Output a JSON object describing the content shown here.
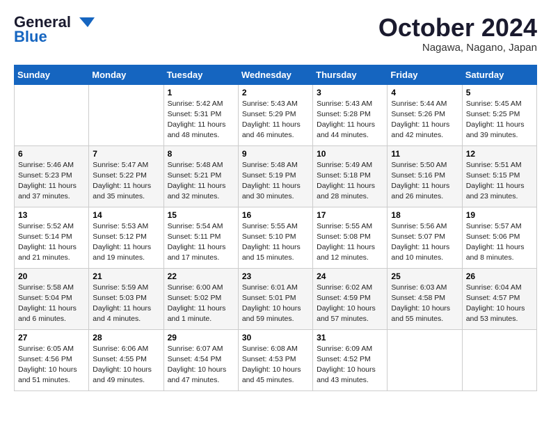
{
  "header": {
    "logo_line1": "General",
    "logo_line2": "Blue",
    "month": "October 2024",
    "location": "Nagawa, Nagano, Japan"
  },
  "weekdays": [
    "Sunday",
    "Monday",
    "Tuesday",
    "Wednesday",
    "Thursday",
    "Friday",
    "Saturday"
  ],
  "weeks": [
    [
      {
        "day": "",
        "info": ""
      },
      {
        "day": "",
        "info": ""
      },
      {
        "day": "1",
        "info": "Sunrise: 5:42 AM\nSunset: 5:31 PM\nDaylight: 11 hours and 48 minutes."
      },
      {
        "day": "2",
        "info": "Sunrise: 5:43 AM\nSunset: 5:29 PM\nDaylight: 11 hours and 46 minutes."
      },
      {
        "day": "3",
        "info": "Sunrise: 5:43 AM\nSunset: 5:28 PM\nDaylight: 11 hours and 44 minutes."
      },
      {
        "day": "4",
        "info": "Sunrise: 5:44 AM\nSunset: 5:26 PM\nDaylight: 11 hours and 42 minutes."
      },
      {
        "day": "5",
        "info": "Sunrise: 5:45 AM\nSunset: 5:25 PM\nDaylight: 11 hours and 39 minutes."
      }
    ],
    [
      {
        "day": "6",
        "info": "Sunrise: 5:46 AM\nSunset: 5:23 PM\nDaylight: 11 hours and 37 minutes."
      },
      {
        "day": "7",
        "info": "Sunrise: 5:47 AM\nSunset: 5:22 PM\nDaylight: 11 hours and 35 minutes."
      },
      {
        "day": "8",
        "info": "Sunrise: 5:48 AM\nSunset: 5:21 PM\nDaylight: 11 hours and 32 minutes."
      },
      {
        "day": "9",
        "info": "Sunrise: 5:48 AM\nSunset: 5:19 PM\nDaylight: 11 hours and 30 minutes."
      },
      {
        "day": "10",
        "info": "Sunrise: 5:49 AM\nSunset: 5:18 PM\nDaylight: 11 hours and 28 minutes."
      },
      {
        "day": "11",
        "info": "Sunrise: 5:50 AM\nSunset: 5:16 PM\nDaylight: 11 hours and 26 minutes."
      },
      {
        "day": "12",
        "info": "Sunrise: 5:51 AM\nSunset: 5:15 PM\nDaylight: 11 hours and 23 minutes."
      }
    ],
    [
      {
        "day": "13",
        "info": "Sunrise: 5:52 AM\nSunset: 5:14 PM\nDaylight: 11 hours and 21 minutes."
      },
      {
        "day": "14",
        "info": "Sunrise: 5:53 AM\nSunset: 5:12 PM\nDaylight: 11 hours and 19 minutes."
      },
      {
        "day": "15",
        "info": "Sunrise: 5:54 AM\nSunset: 5:11 PM\nDaylight: 11 hours and 17 minutes."
      },
      {
        "day": "16",
        "info": "Sunrise: 5:55 AM\nSunset: 5:10 PM\nDaylight: 11 hours and 15 minutes."
      },
      {
        "day": "17",
        "info": "Sunrise: 5:55 AM\nSunset: 5:08 PM\nDaylight: 11 hours and 12 minutes."
      },
      {
        "day": "18",
        "info": "Sunrise: 5:56 AM\nSunset: 5:07 PM\nDaylight: 11 hours and 10 minutes."
      },
      {
        "day": "19",
        "info": "Sunrise: 5:57 AM\nSunset: 5:06 PM\nDaylight: 11 hours and 8 minutes."
      }
    ],
    [
      {
        "day": "20",
        "info": "Sunrise: 5:58 AM\nSunset: 5:04 PM\nDaylight: 11 hours and 6 minutes."
      },
      {
        "day": "21",
        "info": "Sunrise: 5:59 AM\nSunset: 5:03 PM\nDaylight: 11 hours and 4 minutes."
      },
      {
        "day": "22",
        "info": "Sunrise: 6:00 AM\nSunset: 5:02 PM\nDaylight: 11 hours and 1 minute."
      },
      {
        "day": "23",
        "info": "Sunrise: 6:01 AM\nSunset: 5:01 PM\nDaylight: 10 hours and 59 minutes."
      },
      {
        "day": "24",
        "info": "Sunrise: 6:02 AM\nSunset: 4:59 PM\nDaylight: 10 hours and 57 minutes."
      },
      {
        "day": "25",
        "info": "Sunrise: 6:03 AM\nSunset: 4:58 PM\nDaylight: 10 hours and 55 minutes."
      },
      {
        "day": "26",
        "info": "Sunrise: 6:04 AM\nSunset: 4:57 PM\nDaylight: 10 hours and 53 minutes."
      }
    ],
    [
      {
        "day": "27",
        "info": "Sunrise: 6:05 AM\nSunset: 4:56 PM\nDaylight: 10 hours and 51 minutes."
      },
      {
        "day": "28",
        "info": "Sunrise: 6:06 AM\nSunset: 4:55 PM\nDaylight: 10 hours and 49 minutes."
      },
      {
        "day": "29",
        "info": "Sunrise: 6:07 AM\nSunset: 4:54 PM\nDaylight: 10 hours and 47 minutes."
      },
      {
        "day": "30",
        "info": "Sunrise: 6:08 AM\nSunset: 4:53 PM\nDaylight: 10 hours and 45 minutes."
      },
      {
        "day": "31",
        "info": "Sunrise: 6:09 AM\nSunset: 4:52 PM\nDaylight: 10 hours and 43 minutes."
      },
      {
        "day": "",
        "info": ""
      },
      {
        "day": "",
        "info": ""
      }
    ]
  ]
}
